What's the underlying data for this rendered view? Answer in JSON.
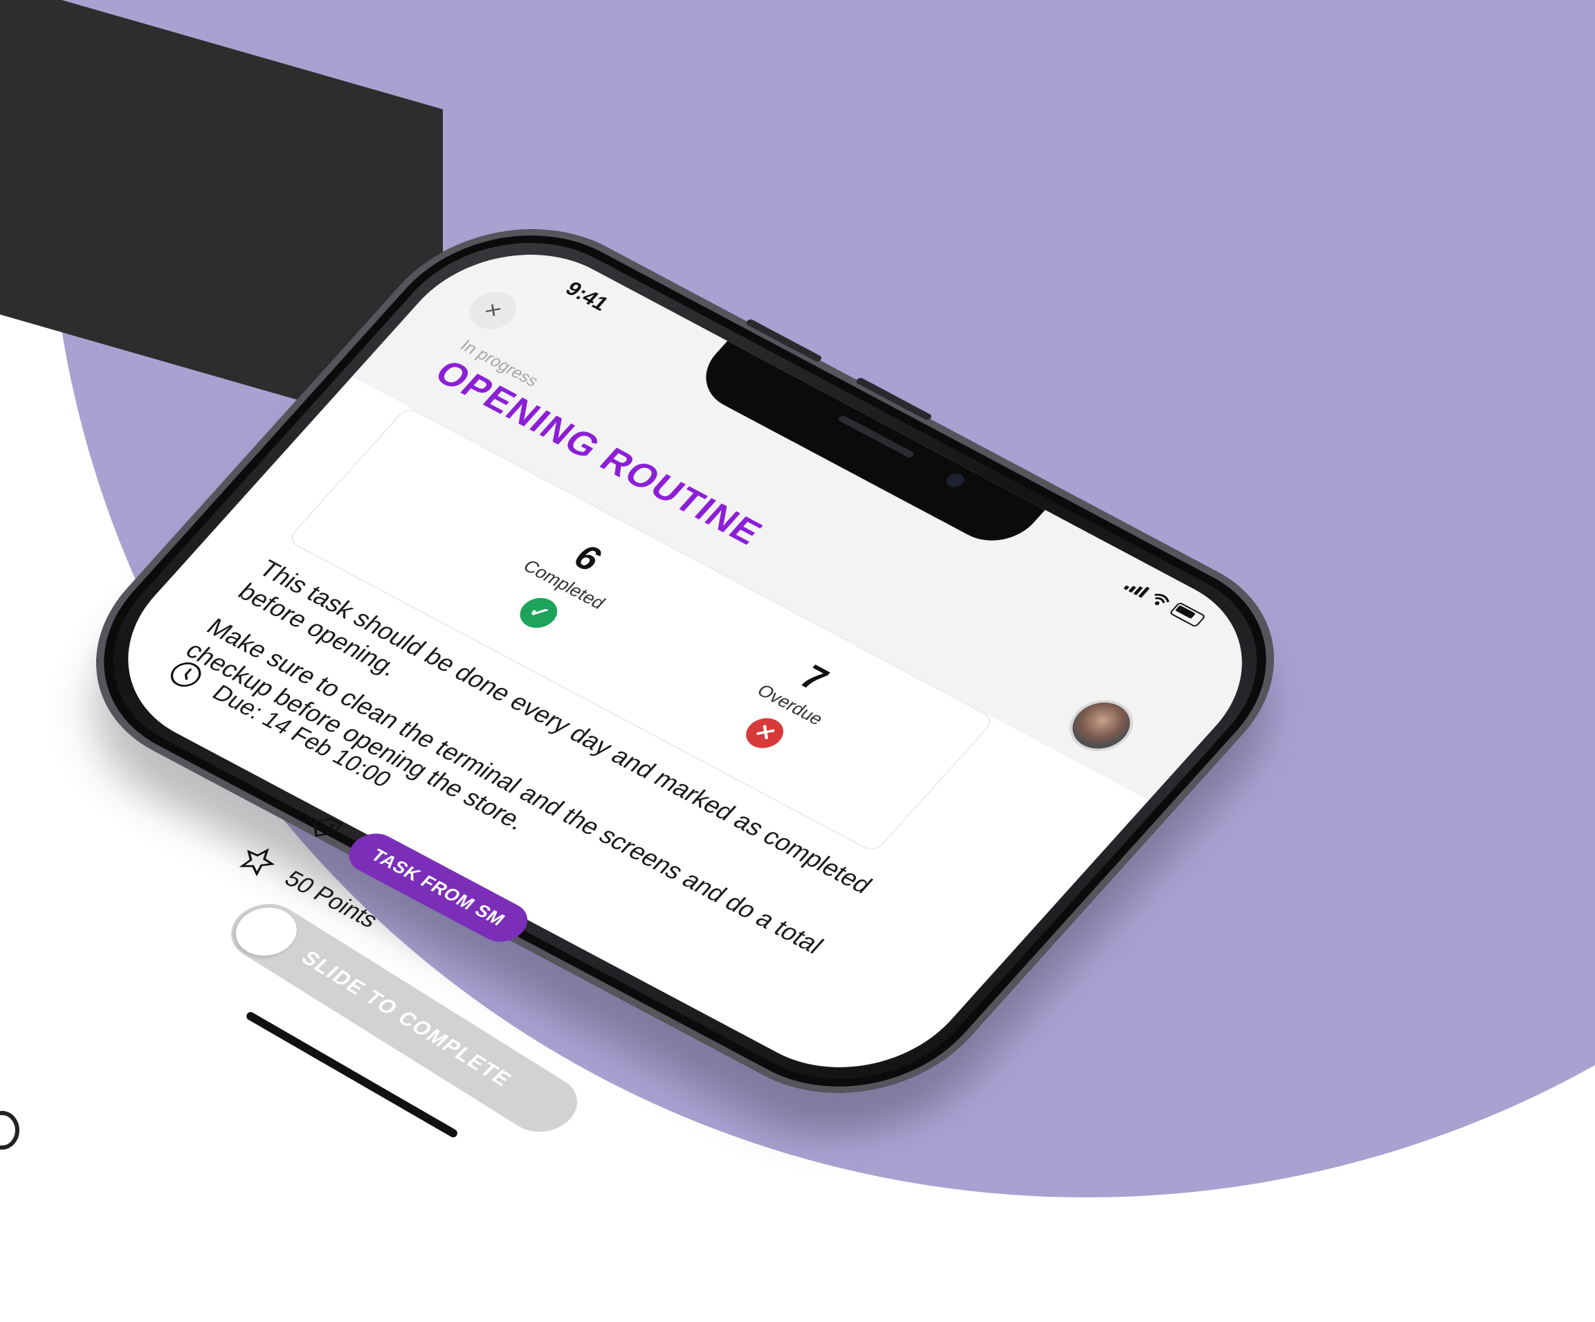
{
  "status_bar": {
    "time": "9:41"
  },
  "task": {
    "status_label": "In progress",
    "title": "OPENING ROUTINE",
    "close_icon": "close-icon",
    "stats": {
      "completed_value": "6",
      "completed_label": "Completed",
      "overdue_value": "7",
      "overdue_label": "Overdue"
    },
    "description_1": "This task should be done every day and marked as completed before opening.",
    "description_2": "Make sure to clean the terminal and the screens and do a total checkup before opening the store.",
    "due": "Due: 14 Feb 10:00",
    "tag": "TASK FROM SM",
    "points": "50 Points"
  },
  "slider": {
    "label": "SLIDE TO COMPLETE"
  },
  "colors": {
    "background_lavender": "#a8a2d1",
    "title_purple": "#8c1fd6",
    "tag_purple": "#7b2fb8",
    "completed_green": "#1ea35b",
    "overdue_red": "#d63a3a"
  }
}
